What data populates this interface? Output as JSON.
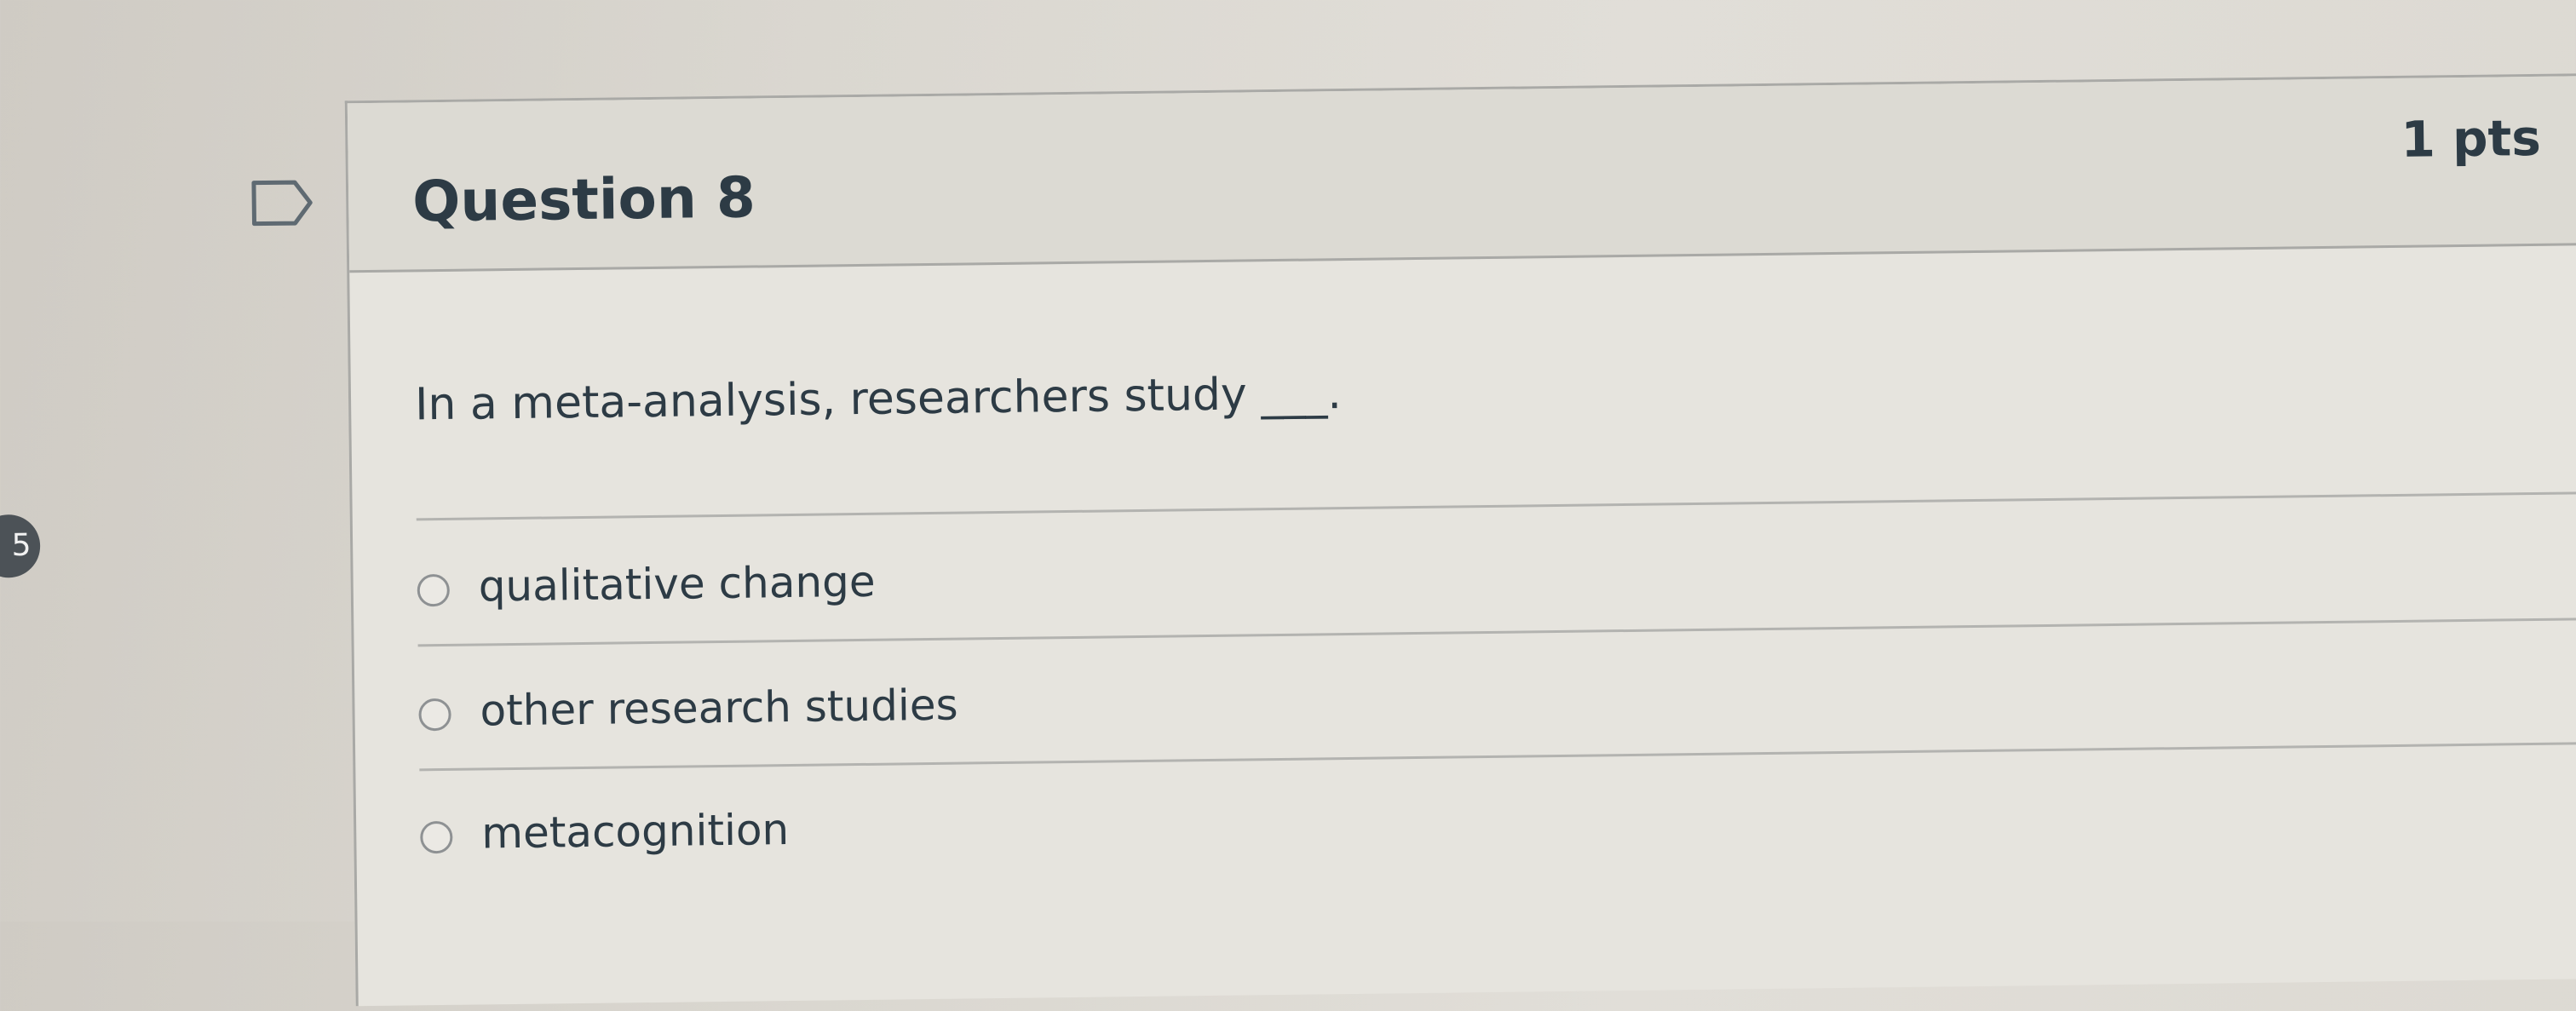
{
  "question": {
    "title": "Question 8",
    "points": "1 pts",
    "text": "In a meta-analysis, researchers study ___.",
    "flag_icon": "flag-bookmark-icon"
  },
  "answers": [
    {
      "label": "qualitative change",
      "selected": false
    },
    {
      "label": "other research studies",
      "selected": false
    },
    {
      "label": "metacognition",
      "selected": false
    }
  ],
  "side_badge": {
    "text": "5"
  },
  "colors": {
    "text": "#2d3b45",
    "card_background": "#e6e4de",
    "header_background": "#dcdad3",
    "border": "#a9a9a6",
    "badge": "#4c5257"
  }
}
